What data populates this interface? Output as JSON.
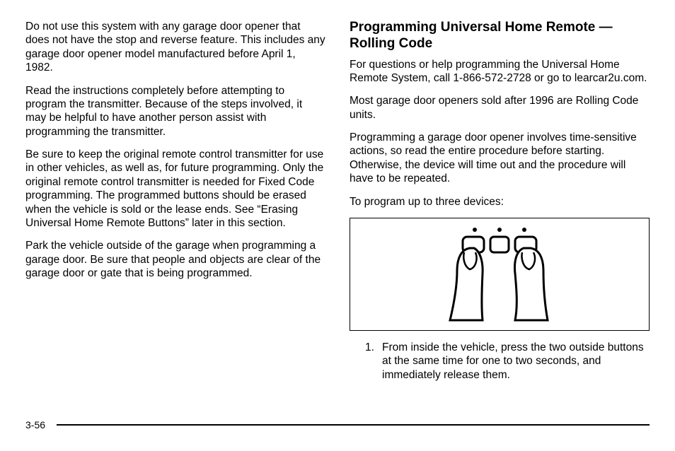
{
  "left": {
    "p1": "Do not use this system with any garage door opener that does not have the stop and reverse feature. This includes any garage door opener model manufactured before April 1, 1982.",
    "p2": "Read the instructions completely before attempting to program the transmitter. Because of the steps involved, it may be helpful to have another person assist with programming the transmitter.",
    "p3": "Be sure to keep the original remote control transmitter for use in other vehicles, as well as, for future programming. Only the original remote control transmitter is needed for Fixed Code programming. The programmed buttons should be erased when the vehicle is sold or the lease ends. See “Erasing Universal Home Remote Buttons” later in this section.",
    "p4": "Park the vehicle outside of the garage when programming a garage door. Be sure that people and objects are clear of the garage door or gate that is being programmed."
  },
  "right": {
    "heading": "Programming Universal Home Remote — Rolling Code",
    "p1": "For questions or help programming the Universal Home Remote System, call 1-866-572-2728 or go to learcar2u.com.",
    "p2": "Most garage door openers sold after 1996 are Rolling Code units.",
    "p3": "Programming a garage door opener involves time-sensitive actions, so read the entire procedure before starting. Otherwise, the device will time out and the procedure will have to be repeated.",
    "p4": "To program up to three devices:",
    "step1_num": "1.",
    "step1_text": "From inside the vehicle, press the two outside buttons at the same time for one to two seconds, and immediately release them."
  },
  "page_number": "3-56"
}
